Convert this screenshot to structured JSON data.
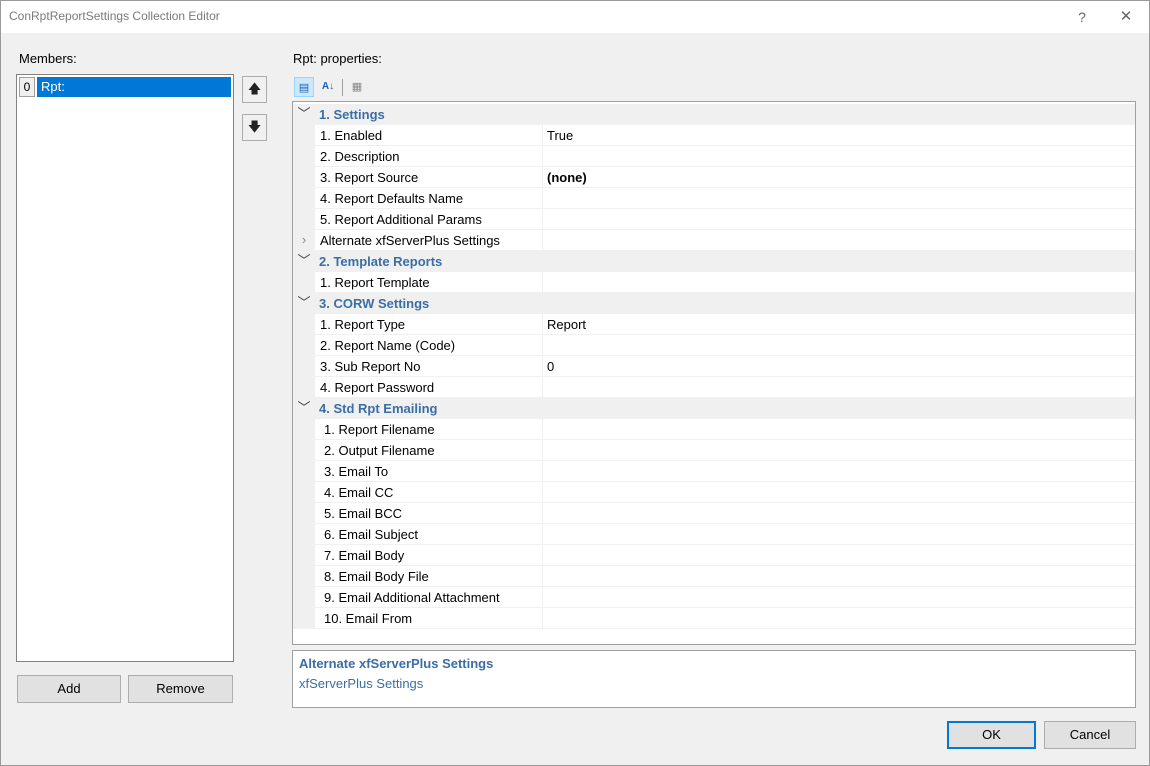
{
  "window": {
    "title": "ConRptReportSettings Collection Editor",
    "help_glyph": "?",
    "close_glyph": "✕"
  },
  "members": {
    "label": "Members:",
    "items": [
      {
        "index": "0",
        "label": "Rpt:"
      }
    ],
    "move_up_glyph": "🡅",
    "move_down_glyph": "🡇",
    "add_label": "Add",
    "remove_label": "Remove"
  },
  "properties": {
    "label": "Rpt: properties:",
    "toolbar": {
      "categorized_glyph": "▤",
      "alphabetical_glyph": "A↓",
      "property_pages_glyph": "▦"
    },
    "rows": [
      {
        "kind": "category",
        "toggle": "﹀",
        "label": "1. Settings"
      },
      {
        "kind": "prop",
        "name": "1. Enabled",
        "value": "True"
      },
      {
        "kind": "prop",
        "name": "2. Description",
        "value": ""
      },
      {
        "kind": "prop",
        "name": "3. Report Source",
        "value": "(none)",
        "bold": true
      },
      {
        "kind": "prop",
        "name": "4. Report Defaults Name",
        "value": ""
      },
      {
        "kind": "prop",
        "name": "5. Report Additional Params",
        "value": ""
      },
      {
        "kind": "expandable",
        "toggle": "›",
        "name": "Alternate xfServerPlus Settings",
        "value": ""
      },
      {
        "kind": "category",
        "toggle": "﹀",
        "label": "2. Template Reports"
      },
      {
        "kind": "prop",
        "name": "1. Report Template",
        "value": ""
      },
      {
        "kind": "category",
        "toggle": "﹀",
        "label": "3. CORW Settings"
      },
      {
        "kind": "prop",
        "name": "1. Report Type",
        "value": "Report"
      },
      {
        "kind": "prop",
        "name": "2. Report Name (Code)",
        "value": ""
      },
      {
        "kind": "prop",
        "name": "3. Sub Report No",
        "value": "0"
      },
      {
        "kind": "prop",
        "name": "4. Report Password",
        "value": ""
      },
      {
        "kind": "category",
        "toggle": "﹀",
        "label": "4. Std Rpt Emailing"
      },
      {
        "kind": "prop",
        "name": "1. Report Filename",
        "value": "",
        "deep": true
      },
      {
        "kind": "prop",
        "name": "2. Output Filename",
        "value": "",
        "deep": true
      },
      {
        "kind": "prop",
        "name": "3. Email To",
        "value": "",
        "deep": true
      },
      {
        "kind": "prop",
        "name": "4. Email CC",
        "value": "",
        "deep": true
      },
      {
        "kind": "prop",
        "name": "5. Email BCC",
        "value": "",
        "deep": true
      },
      {
        "kind": "prop",
        "name": "6. Email Subject",
        "value": "",
        "deep": true
      },
      {
        "kind": "prop",
        "name": "7. Email Body",
        "value": "",
        "deep": true
      },
      {
        "kind": "prop",
        "name": "8. Email Body File",
        "value": "",
        "deep": true
      },
      {
        "kind": "prop",
        "name": "9. Email Additional Attachment",
        "value": "",
        "deep": true
      },
      {
        "kind": "prop",
        "name": "10. Email From",
        "value": "",
        "deep": true
      }
    ]
  },
  "description": {
    "title": "Alternate xfServerPlus Settings",
    "body": "xfServerPlus Settings"
  },
  "buttons": {
    "ok_label": "OK",
    "cancel_label": "Cancel"
  }
}
